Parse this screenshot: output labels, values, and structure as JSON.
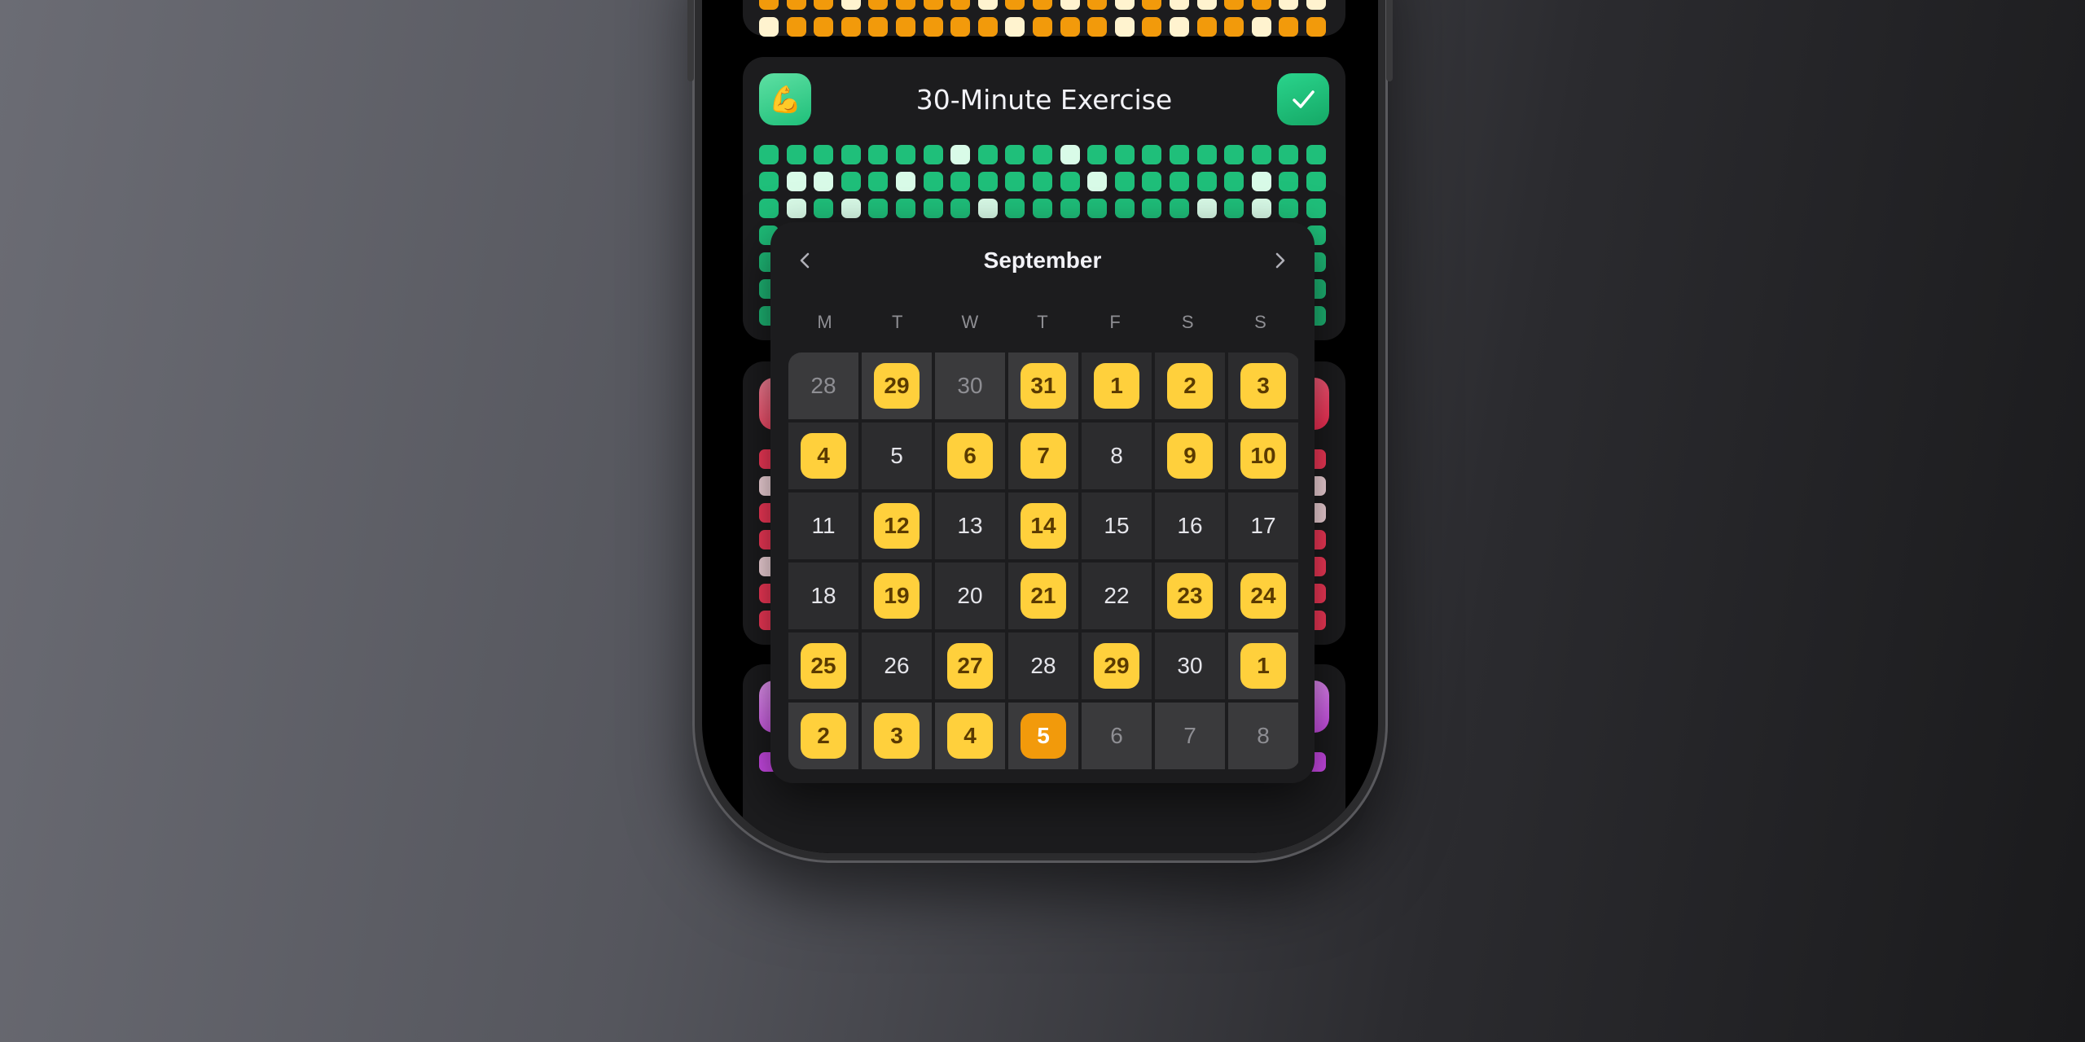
{
  "habits": [
    {
      "id": "top",
      "color": "#f29a0b",
      "light": "#fff3cf"
    },
    {
      "id": "exercise",
      "title": "30-Minute Exercise",
      "icon": "flexed-biceps-icon",
      "icon_glyph": "💪",
      "color": "#1fbf7a",
      "light": "#d9fbe8"
    },
    {
      "id": "red",
      "color": "#ff3b5c",
      "light": "#ffe0e6"
    },
    {
      "id": "purple",
      "color": "#d24cf0",
      "light": "#f6e0fc"
    }
  ],
  "calendar": {
    "month": "September",
    "prev_label": "previous month",
    "next_label": "next month",
    "weekdays": [
      "M",
      "T",
      "W",
      "T",
      "F",
      "S",
      "S"
    ],
    "weeks": [
      [
        {
          "d": "28",
          "m": "out",
          "s": ""
        },
        {
          "d": "29",
          "m": "out",
          "s": "done"
        },
        {
          "d": "30",
          "m": "out",
          "s": ""
        },
        {
          "d": "31",
          "m": "out",
          "s": "done"
        },
        {
          "d": "1",
          "m": "cur",
          "s": "done"
        },
        {
          "d": "2",
          "m": "cur",
          "s": "done"
        },
        {
          "d": "3",
          "m": "cur",
          "s": "done"
        }
      ],
      [
        {
          "d": "4",
          "m": "cur",
          "s": "done"
        },
        {
          "d": "5",
          "m": "cur",
          "s": ""
        },
        {
          "d": "6",
          "m": "cur",
          "s": "done"
        },
        {
          "d": "7",
          "m": "cur",
          "s": "done"
        },
        {
          "d": "8",
          "m": "cur",
          "s": ""
        },
        {
          "d": "9",
          "m": "cur",
          "s": "done"
        },
        {
          "d": "10",
          "m": "cur",
          "s": "done"
        }
      ],
      [
        {
          "d": "11",
          "m": "cur",
          "s": ""
        },
        {
          "d": "12",
          "m": "cur",
          "s": "done"
        },
        {
          "d": "13",
          "m": "cur",
          "s": ""
        },
        {
          "d": "14",
          "m": "cur",
          "s": "done"
        },
        {
          "d": "15",
          "m": "cur",
          "s": ""
        },
        {
          "d": "16",
          "m": "cur",
          "s": ""
        },
        {
          "d": "17",
          "m": "cur",
          "s": ""
        }
      ],
      [
        {
          "d": "18",
          "m": "cur",
          "s": ""
        },
        {
          "d": "19",
          "m": "cur",
          "s": "done"
        },
        {
          "d": "20",
          "m": "cur",
          "s": ""
        },
        {
          "d": "21",
          "m": "cur",
          "s": "done"
        },
        {
          "d": "22",
          "m": "cur",
          "s": ""
        },
        {
          "d": "23",
          "m": "cur",
          "s": "done"
        },
        {
          "d": "24",
          "m": "cur",
          "s": "done"
        }
      ],
      [
        {
          "d": "25",
          "m": "cur",
          "s": "done"
        },
        {
          "d": "26",
          "m": "cur",
          "s": ""
        },
        {
          "d": "27",
          "m": "cur",
          "s": "done"
        },
        {
          "d": "28",
          "m": "cur",
          "s": ""
        },
        {
          "d": "29",
          "m": "cur",
          "s": "done"
        },
        {
          "d": "30",
          "m": "cur",
          "s": ""
        },
        {
          "d": "1",
          "m": "out",
          "s": "done"
        }
      ],
      [
        {
          "d": "2",
          "m": "out",
          "s": "done"
        },
        {
          "d": "3",
          "m": "out",
          "s": "done"
        },
        {
          "d": "4",
          "m": "out",
          "s": "done"
        },
        {
          "d": "5",
          "m": "out",
          "s": "today"
        },
        {
          "d": "6",
          "m": "out",
          "s": ""
        },
        {
          "d": "7",
          "m": "out",
          "s": ""
        },
        {
          "d": "8",
          "m": "out",
          "s": ""
        }
      ]
    ]
  }
}
